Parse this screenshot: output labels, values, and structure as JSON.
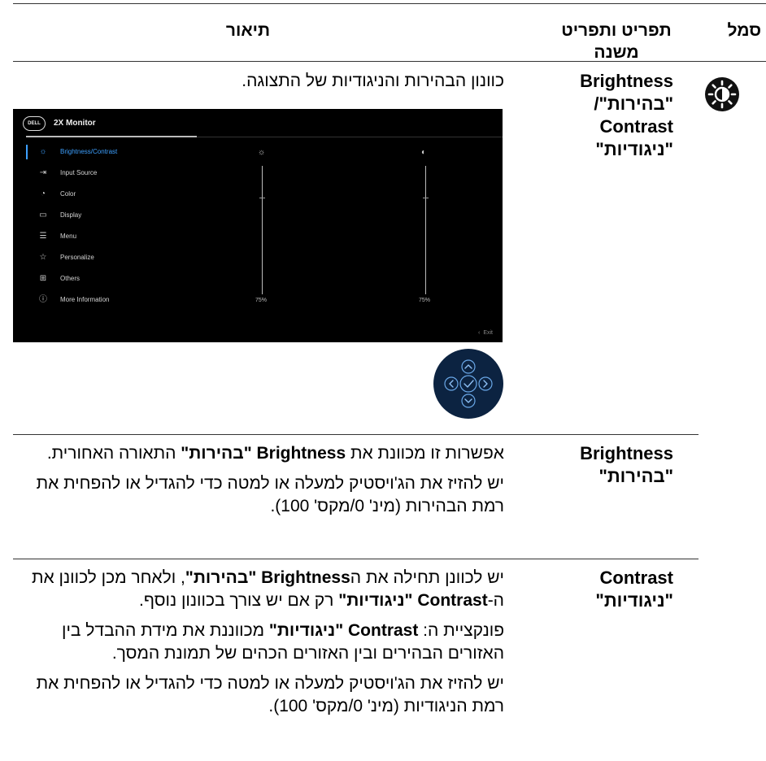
{
  "header": {
    "icon_col": "סמל",
    "menu_col_line1": "תפריט ותפריט",
    "menu_col_line2": "משנה",
    "desc_col": "תיאור"
  },
  "rows": [
    {
      "icon": "brightness-contrast-icon",
      "menu_lines": [
        "Brightness",
        "\"בהירות\"/",
        "Contrast",
        "\"ניגודיות\""
      ],
      "desc_intro": "כוונון הבהירות והניגודיות של התצוגה."
    },
    {
      "menu_lines": [
        "Brightness",
        "\"בהירות\""
      ],
      "p1_a": "אפשרות זו מכוונת את ",
      "p1_b": "Brightness \"בהירות\"",
      "p1_c": " התאורה האחורית.",
      "p2": "יש להזיז את הג'ויסטיק למעלה או למטה כדי להגדיל או להפחית את רמת הבהירות (מינ' 0/מקס' 100)."
    },
    {
      "menu_lines": [
        "Contrast",
        "\"ניגודיות\""
      ],
      "p1_a": "יש לכוונן תחילה את ה",
      "p1_b": "Brightness \"בהירות\"",
      "p1_c": ", ולאחר מכן לכוונן את ה-",
      "p1_d": "Contrast \"ניגודיות\"",
      "p1_e": " רק אם יש צורך בכוונון נוסף.",
      "p2_a": "פונקציית ה: ",
      "p2_b": "Contrast \"ניגודיות\"",
      "p2_c": " מכווננת את מידת ההבדל בין האזורים הבהירים ובין האזורים הכהים של תמונת המסך.",
      "p3": "יש להזיז את הג'ויסטיק למעלה או למטה כדי להגדיל או להפחית את רמת הניגודיות (מינ' 0/מקס' 100)."
    }
  ],
  "osd": {
    "logo": "DELL",
    "title": "2X Monitor",
    "menu": [
      {
        "icon": "sun-icon",
        "label": "Brightness/Contrast",
        "active": true
      },
      {
        "icon": "input-icon",
        "label": "Input Source"
      },
      {
        "icon": "palette-icon",
        "label": "Color"
      },
      {
        "icon": "display-icon",
        "label": "Display"
      },
      {
        "icon": "menu-icon",
        "label": "Menu"
      },
      {
        "icon": "star-icon",
        "label": "Personalize"
      },
      {
        "icon": "others-icon",
        "label": "Others"
      },
      {
        "icon": "info-icon",
        "label": "More Information"
      }
    ],
    "brightness_value": "75%",
    "contrast_value": "75%",
    "exit_label": "Exit"
  },
  "colors": {
    "accent": "#3da0ff",
    "osd_bg": "#000000",
    "joystick_bg": "#0c2341"
  }
}
